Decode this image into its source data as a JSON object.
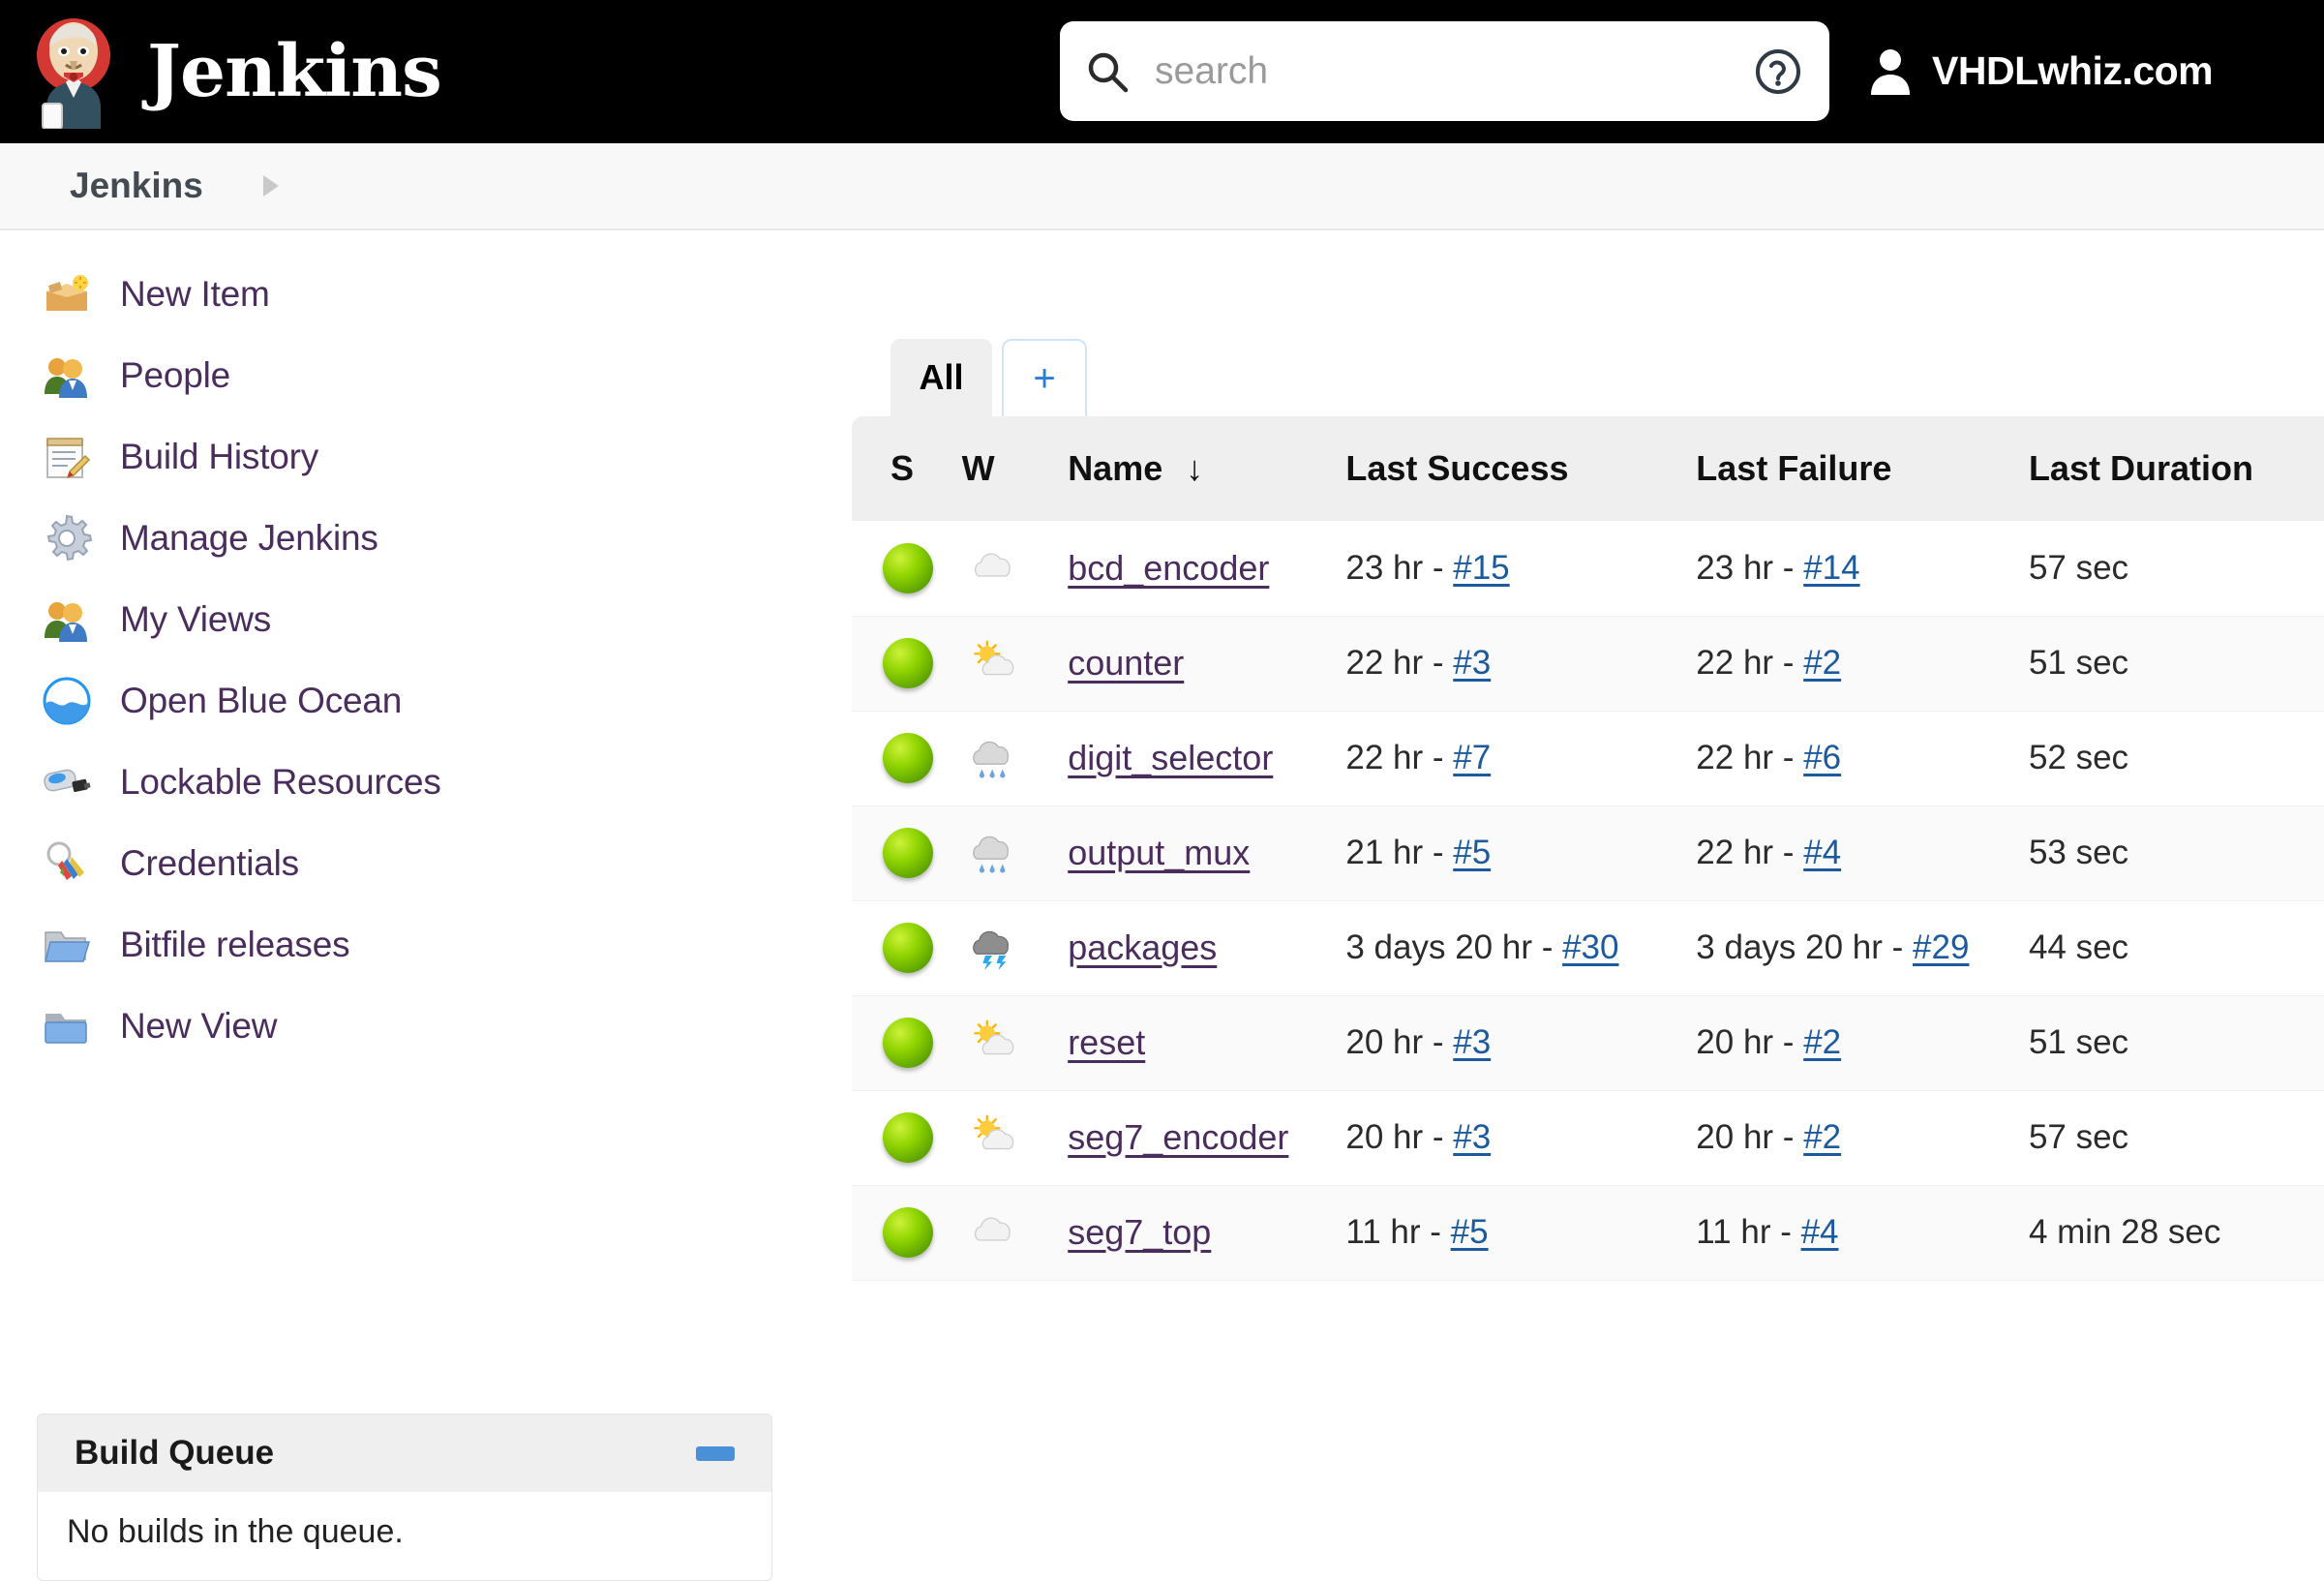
{
  "header": {
    "brand": "Jenkins",
    "logo_icon": "jenkins-butler-icon",
    "search": {
      "icon": "search-icon",
      "placeholder": "search",
      "value": "",
      "help_icon": "help-circle-icon"
    },
    "user": {
      "icon": "person-icon",
      "name": "VHDLwhiz.com"
    }
  },
  "breadcrumb": {
    "root": "Jenkins",
    "chevron_icon": "chevron-right-icon"
  },
  "sidebar": {
    "items": [
      {
        "label": "New Item",
        "icon": "new-item-box-icon"
      },
      {
        "label": "People",
        "icon": "people-icon"
      },
      {
        "label": "Build History",
        "icon": "build-history-notepad-icon"
      },
      {
        "label": "Manage Jenkins",
        "icon": "gear-icon"
      },
      {
        "label": "My Views",
        "icon": "people-icon"
      },
      {
        "label": "Open Blue Ocean",
        "icon": "blue-ocean-icon"
      },
      {
        "label": "Lockable Resources",
        "icon": "usb-device-icon"
      },
      {
        "label": "Credentials",
        "icon": "keys-icon"
      },
      {
        "label": "Bitfile releases",
        "icon": "open-folder-icon"
      },
      {
        "label": "New View",
        "icon": "folder-icon"
      }
    ],
    "build_queue": {
      "title": "Build Queue",
      "collapse_icon": "minus-icon",
      "empty_text": "No builds in the queue."
    }
  },
  "main": {
    "tabs": [
      {
        "label": "All",
        "active": true
      },
      {
        "label": "+",
        "active": false
      }
    ],
    "table": {
      "columns": [
        "S",
        "W",
        "Name",
        "Last Success",
        "Last Failure",
        "Last Duration"
      ],
      "sort_column": "Name",
      "sort_icon": "arrow-down-icon",
      "rows": [
        {
          "status": "green-ball",
          "weather": "cloudy",
          "name": "bcd_encoder",
          "last_success_time": "23 hr - ",
          "last_success_build": "#15",
          "last_failure_time": "23 hr - ",
          "last_failure_build": "#14",
          "last_duration": "57 sec"
        },
        {
          "status": "green-ball",
          "weather": "partly-sunny",
          "name": "counter",
          "last_success_time": "22 hr - ",
          "last_success_build": "#3",
          "last_failure_time": "22 hr - ",
          "last_failure_build": "#2",
          "last_duration": "51 sec"
        },
        {
          "status": "green-ball",
          "weather": "rain",
          "name": "digit_selector",
          "last_success_time": "22 hr - ",
          "last_success_build": "#7",
          "last_failure_time": "22 hr - ",
          "last_failure_build": "#6",
          "last_duration": "52 sec"
        },
        {
          "status": "green-ball",
          "weather": "rain",
          "name": "output_mux",
          "last_success_time": "21 hr - ",
          "last_success_build": "#5",
          "last_failure_time": "22 hr - ",
          "last_failure_build": "#4",
          "last_duration": "53 sec"
        },
        {
          "status": "green-ball",
          "weather": "storm",
          "name": "packages",
          "last_success_time": "3 days 20 hr - ",
          "last_success_build": "#30",
          "last_failure_time": "3 days 20 hr - ",
          "last_failure_build": "#29",
          "last_duration": "44 sec"
        },
        {
          "status": "green-ball",
          "weather": "partly-sunny",
          "name": "reset",
          "last_success_time": "20 hr - ",
          "last_success_build": "#3",
          "last_failure_time": "20 hr - ",
          "last_failure_build": "#2",
          "last_duration": "51 sec"
        },
        {
          "status": "green-ball",
          "weather": "partly-sunny",
          "name": "seg7_encoder",
          "last_success_time": "20 hr - ",
          "last_success_build": "#3",
          "last_failure_time": "20 hr - ",
          "last_failure_build": "#2",
          "last_duration": "57 sec"
        },
        {
          "status": "green-ball",
          "weather": "cloudy",
          "name": "seg7_top",
          "last_success_time": "11 hr - ",
          "last_success_build": "#5",
          "last_failure_time": "11 hr - ",
          "last_failure_build": "#4",
          "last_duration": "4 min 28 sec"
        }
      ]
    }
  },
  "colors": {
    "header_bg": "#000000",
    "status_green": "#8fd400",
    "job_link": "#4a2d5c",
    "build_link": "#1c5a9e",
    "tab_active_bg": "#efefef",
    "accent_blue": "#2a7fd4"
  }
}
